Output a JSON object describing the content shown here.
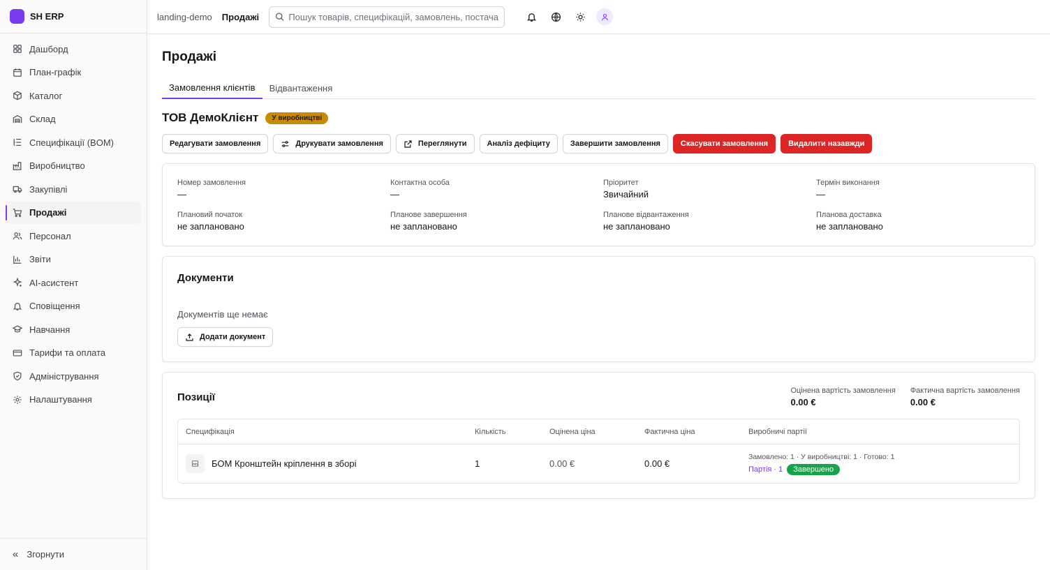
{
  "brand": {
    "name": "SH ERP",
    "color": "#7c3aed"
  },
  "sidebar": {
    "items": [
      {
        "label": "Дашборд",
        "icon": "dashboard-icon"
      },
      {
        "label": "План-графік",
        "icon": "calendar-icon"
      },
      {
        "label": "Каталог",
        "icon": "box-icon"
      },
      {
        "label": "Склад",
        "icon": "warehouse-icon"
      },
      {
        "label": "Специфікації (BOM)",
        "icon": "list-tree-icon"
      },
      {
        "label": "Виробництво",
        "icon": "factory-icon"
      },
      {
        "label": "Закупівлі",
        "icon": "truck-icon"
      },
      {
        "label": "Продажі",
        "icon": "cart-icon",
        "active": true
      },
      {
        "label": "Персонал",
        "icon": "users-icon"
      },
      {
        "label": "Звіти",
        "icon": "bar-chart-icon"
      },
      {
        "label": "AI-асистент",
        "icon": "sparkles-icon"
      },
      {
        "label": "Сповіщення",
        "icon": "bell-icon"
      },
      {
        "label": "Навчання",
        "icon": "graduation-cap-icon"
      },
      {
        "label": "Тарифи та оплата",
        "icon": "credit-card-icon"
      },
      {
        "label": "Адміністрування",
        "icon": "shield-icon"
      },
      {
        "label": "Налаштування",
        "icon": "gear-icon"
      }
    ],
    "collapse_label": "Згорнути"
  },
  "topbar": {
    "workspace": "landing-demo",
    "section": "Продажі",
    "search_placeholder": "Пошук товарів, специфікацій, замовлень, постачальників"
  },
  "page": {
    "title": "Продажі",
    "tabs": [
      {
        "label": "Замовлення клієнтів",
        "active": true
      },
      {
        "label": "Відвантаження",
        "active": false
      }
    ]
  },
  "order": {
    "customer": "ТОВ ДемоКлієнт",
    "status": "У виробництві",
    "actions": {
      "edit": "Редагувати замовлення",
      "print": "Друкувати замовлення",
      "view": "Переглянути",
      "deficit": "Аналіз дефіциту",
      "complete": "Завершити замовлення",
      "cancel": "Скасувати замовлення",
      "delete": "Видалити назавжди"
    },
    "fields": {
      "number": {
        "label": "Номер замовлення",
        "value": "—"
      },
      "contact": {
        "label": "Контактна особа",
        "value": "—"
      },
      "priority": {
        "label": "Пріоритет",
        "value": "Звичайний"
      },
      "deadline": {
        "label": "Термін виконання",
        "value": "—"
      },
      "planned_start": {
        "label": "Плановий початок",
        "value": "не заплановано"
      },
      "planned_finish": {
        "label": "Планове завершення",
        "value": "не заплановано"
      },
      "planned_shipment": {
        "label": "Планове відвантаження",
        "value": "не заплановано"
      },
      "planned_delivery": {
        "label": "Планова доставка",
        "value": "не заплановано"
      }
    }
  },
  "documents": {
    "title": "Документи",
    "empty": "Документів ще немає",
    "add_label": "Додати документ"
  },
  "positions": {
    "title": "Позиції",
    "estimated_label": "Оцінена вартість замовлення",
    "estimated_value": "0.00 €",
    "actual_label": "Фактична вартість замовлення",
    "actual_value": "0.00 €",
    "columns": {
      "spec": "Специфікація",
      "qty": "Кількість",
      "est_price": "Оцінена ціна",
      "act_price": "Фактична ціна",
      "batches": "Виробничі партії"
    },
    "rows": [
      {
        "spec": "БОМ Кронштейн кріплення в зборі",
        "qty": "1",
        "est_price": "0.00 €",
        "act_price": "0.00 €",
        "batch_summary": "Замовлено: 1 · У виробництві: 1 · Готово: 1",
        "batch_link": "Партія · 1",
        "batch_status": "Завершено"
      }
    ]
  },
  "colors": {
    "accent": "#7c3aed",
    "danger": "#dc2626",
    "warning": "#ca8a04",
    "success": "#16a34a"
  }
}
